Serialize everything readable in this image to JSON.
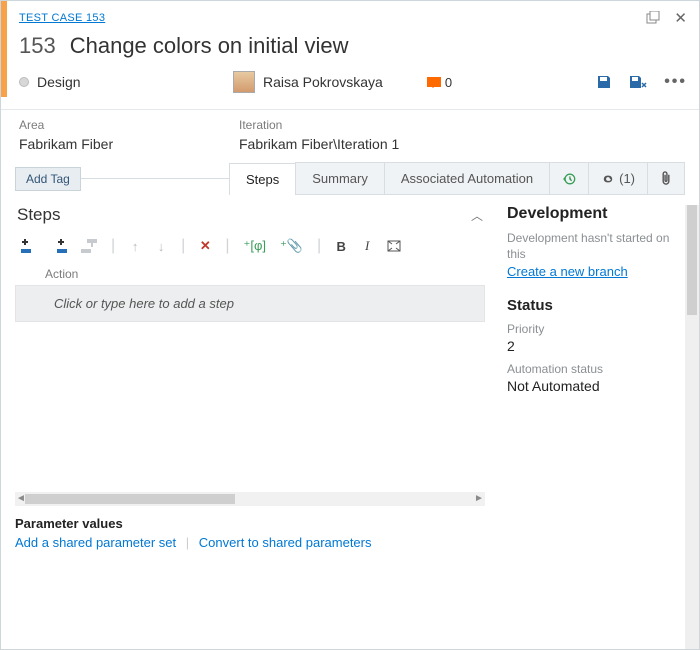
{
  "breadcrumb": "TEST CASE 153",
  "workItem": {
    "id": "153",
    "title": "Change colors on initial view"
  },
  "state": "Design",
  "assignee": "Raisa Pokrovskaya",
  "commentCount": "0",
  "fields": {
    "areaLabel": "Area",
    "areaValue": "Fabrikam Fiber",
    "iterationLabel": "Iteration",
    "iterationValue": "Fabrikam Fiber\\Iteration 1"
  },
  "addTag": "Add Tag",
  "tabs": {
    "steps": "Steps",
    "summary": "Summary",
    "automation": "Associated Automation",
    "linksCount": "(1)"
  },
  "stepsSection": {
    "title": "Steps",
    "actionHeader": "Action",
    "placeholder": "Click or type here to add a step"
  },
  "params": {
    "title": "Parameter values",
    "addShared": "Add a shared parameter set",
    "convert": "Convert to shared parameters"
  },
  "side": {
    "devTitle": "Development",
    "devText": "Development hasn't started on this",
    "devLink": "Create a new branch",
    "statusTitle": "Status",
    "priorityLabel": "Priority",
    "priorityValue": "2",
    "autoLabel": "Automation status",
    "autoValue": "Not Automated"
  }
}
